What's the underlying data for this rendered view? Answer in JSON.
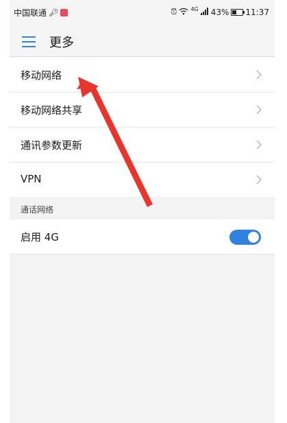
{
  "status_bar": {
    "carrier": "中国联通",
    "signal_label": "4G",
    "battery_percent": "43%",
    "time": "11:37",
    "battery_level": 0.43
  },
  "header": {
    "title": "更多",
    "menu_icon": "hamburger-menu-icon"
  },
  "list": {
    "items": [
      {
        "label": "移动网络"
      },
      {
        "label": "移动网络共享"
      },
      {
        "label": "通讯参数更新"
      },
      {
        "label": "VPN"
      }
    ],
    "section_label": "通话网络",
    "toggle_item": {
      "label": "启用 4G",
      "enabled": true
    }
  },
  "colors": {
    "accent": "#2f82e0",
    "annotation_arrow": "#e8362e"
  }
}
